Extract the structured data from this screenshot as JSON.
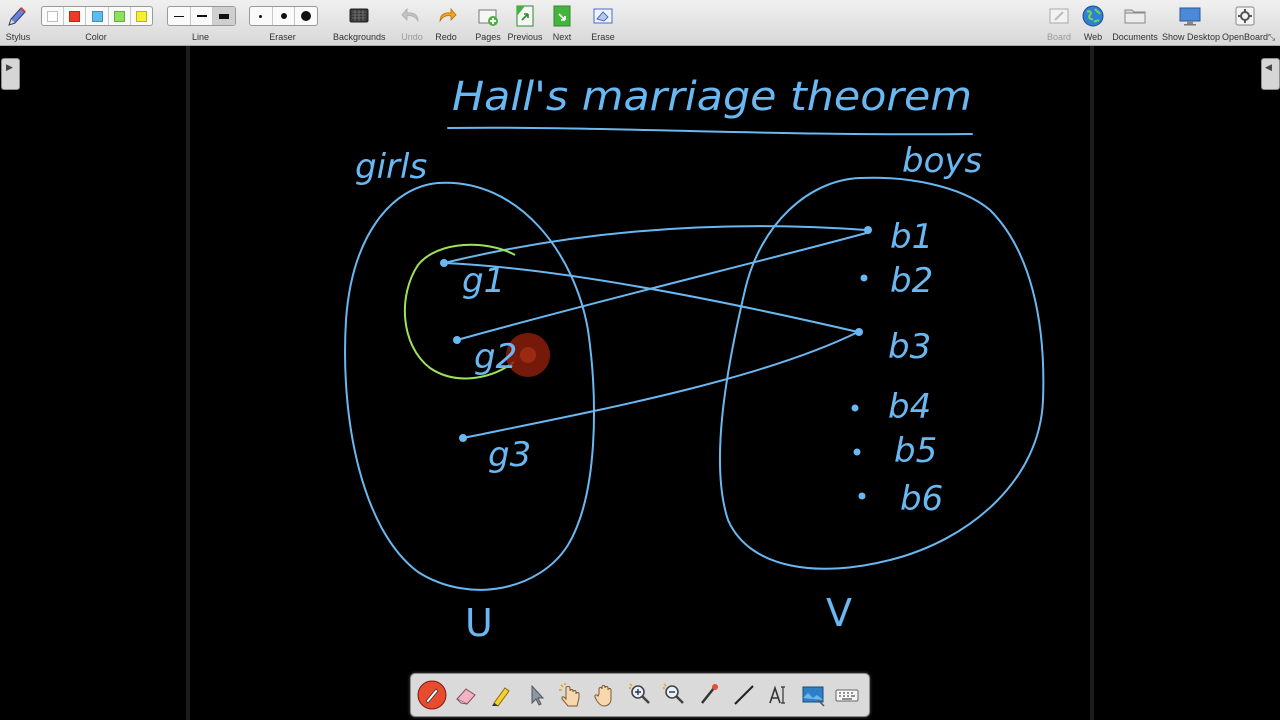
{
  "toolbar": {
    "stylus": "Stylus",
    "color": "Color",
    "colors": [
      "#ffffff",
      "#ef3b24",
      "#5cbcf2",
      "#8ce25a",
      "#f6ee33"
    ],
    "line": "Line",
    "eraser": "Eraser",
    "backgrounds": "Backgrounds",
    "undo": "Undo",
    "redo": "Redo",
    "pages": "Pages",
    "previous": "Previous",
    "next": "Next",
    "erase": "Erase",
    "board": "Board",
    "web": "Web",
    "documents": "Documents",
    "show_desktop": "Show Desktop",
    "openboard": "OpenBoard"
  },
  "board": {
    "title": "Hall's marriage theorem",
    "girls_label": "girls",
    "boys_label": "boys",
    "girls": [
      "g1",
      "g2",
      "g3"
    ],
    "boys": [
      "b1",
      "b2",
      "b3",
      "b4",
      "b5",
      "b6"
    ],
    "set_u": "U",
    "set_v": "V",
    "ink_color": "#6ab8f2",
    "highlight_color": "#9ee25c",
    "pointer_color": "#8a1f0d"
  },
  "dock": {
    "tools": [
      "pen-tool",
      "eraser-tool",
      "highlighter-tool",
      "selector-tool",
      "interact-tool",
      "hand-tool",
      "zoom-in-tool",
      "zoom-out-tool",
      "laser-pointer-tool",
      "line-tool",
      "text-tool",
      "capture-tool",
      "virtual-keyboard-tool"
    ]
  }
}
